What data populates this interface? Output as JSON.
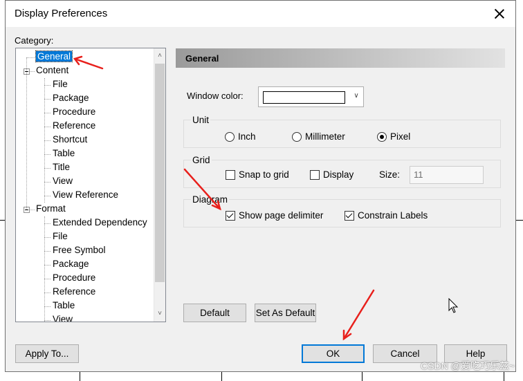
{
  "window": {
    "title": "Display Preferences"
  },
  "category_label": "Category:",
  "tree": {
    "items": [
      {
        "label": "General",
        "level": 1,
        "selected": true
      },
      {
        "label": "Content",
        "level": 1,
        "expander": true
      },
      {
        "label": "File",
        "level": 2
      },
      {
        "label": "Package",
        "level": 2
      },
      {
        "label": "Procedure",
        "level": 2
      },
      {
        "label": "Reference",
        "level": 2
      },
      {
        "label": "Shortcut",
        "level": 2
      },
      {
        "label": "Table",
        "level": 2
      },
      {
        "label": "Title",
        "level": 2
      },
      {
        "label": "View",
        "level": 2
      },
      {
        "label": "View Reference",
        "level": 2
      },
      {
        "label": "Format",
        "level": 1,
        "expander": true
      },
      {
        "label": "Extended Dependency",
        "level": 2
      },
      {
        "label": "File",
        "level": 2
      },
      {
        "label": "Free Symbol",
        "level": 2
      },
      {
        "label": "Package",
        "level": 2
      },
      {
        "label": "Procedure",
        "level": 2
      },
      {
        "label": "Reference",
        "level": 2
      },
      {
        "label": "Table",
        "level": 2
      },
      {
        "label": "View",
        "level": 2
      }
    ]
  },
  "panel": {
    "header": "General",
    "window_color_label": "Window color:",
    "window_color_value": "#ffffff",
    "unit": {
      "label": "Unit",
      "options": [
        "Inch",
        "Millimeter",
        "Pixel"
      ],
      "selected": "Pixel"
    },
    "grid": {
      "label": "Grid",
      "snap_label": "Snap to grid",
      "snap_checked": false,
      "display_label": "Display",
      "display_checked": false,
      "size_label": "Size:",
      "size_value": "11"
    },
    "diagram": {
      "label": "Diagram",
      "show_page_delimiter_label": "Show page delimiter",
      "show_page_delimiter_checked": true,
      "constrain_labels_label": "Constrain Labels",
      "constrain_labels_checked": true
    },
    "default_button": "Default",
    "set_as_default_button": "Set As Default"
  },
  "footer": {
    "apply_to": "Apply To...",
    "ok": "OK",
    "cancel": "Cancel",
    "help": "Help"
  },
  "watermark": "CSDN @爱吃巧乐兹~",
  "colors": {
    "selection": "#0078d7",
    "annotation_arrow": "#e8201c"
  }
}
